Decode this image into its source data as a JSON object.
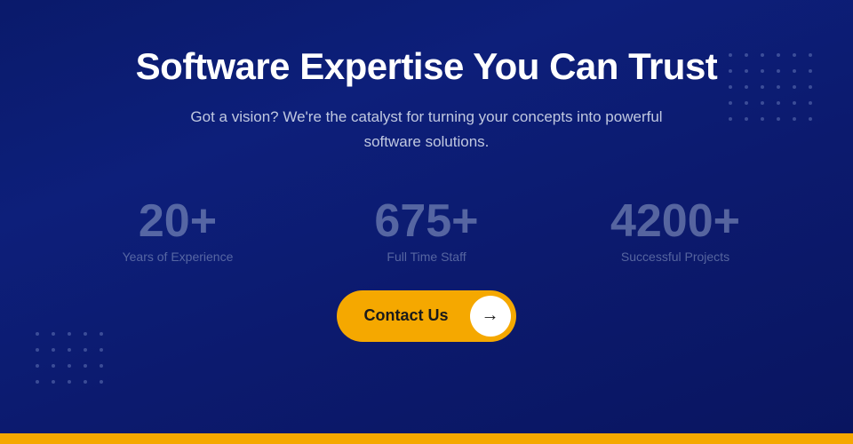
{
  "page": {
    "heading": "Software Expertise You Can Trust",
    "subheading": "Got a vision? We're the catalyst for turning your concepts into powerful software solutions.",
    "stats": [
      {
        "number": "20+",
        "label": "Years of Experience"
      },
      {
        "number": "675+",
        "label": "Full Time Staff"
      },
      {
        "number": "4200+",
        "label": "Successful Projects"
      }
    ],
    "cta_button": "Contact Us",
    "arrow_icon": "→",
    "accent_color": "#f5a800",
    "bg_color": "#0d1f7a"
  }
}
